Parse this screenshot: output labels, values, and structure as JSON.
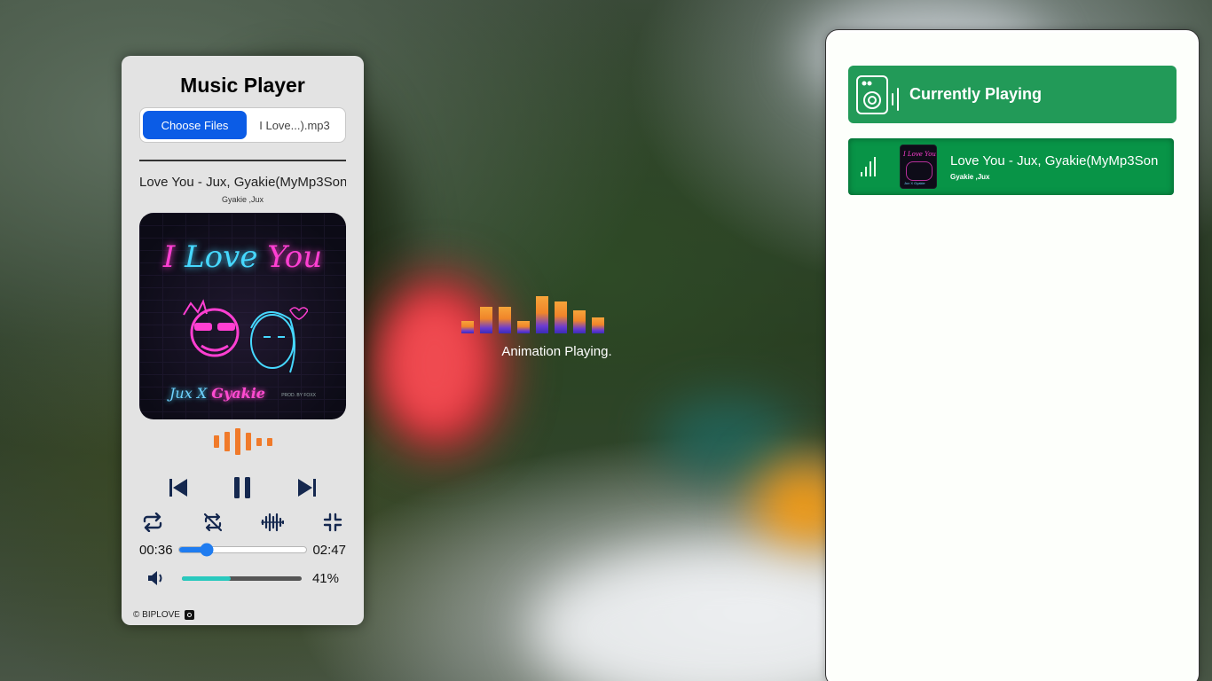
{
  "player": {
    "title": "Music Player",
    "choose_files_label": "Choose Files",
    "file_name": "I Love...).mp3",
    "song_title": "Love You - Jux, Gyakie(MyMp3Song",
    "artist": "Gyakie ,Jux",
    "cover_art": {
      "title_a": "I ",
      "title_b": "Love ",
      "title_c": "You",
      "names_a": "Jux X ",
      "names_b": "Gyakie",
      "prod": "PROD. BY FOXX"
    },
    "current_time": "00:36",
    "duration": "02:47",
    "progress_fraction": 0.22,
    "volume_label": "41%",
    "volume_fraction": 0.41,
    "footer_text": "© BIPLOVE",
    "icons": {
      "previous": "skip-previous-icon",
      "pause": "pause-icon",
      "next": "skip-next-icon",
      "repeat": "repeat-icon",
      "shuffle_off": "shuffle-off-icon",
      "equalizer": "waveform-icon",
      "minimize": "collapse-icon",
      "volume": "volume-icon",
      "github": "github-icon"
    }
  },
  "animation": {
    "status_text": "Animation Playing."
  },
  "queue": {
    "header_title": "Currently Playing",
    "items": [
      {
        "title": "Love You - Jux, Gyakie(MyMp3Song",
        "artist": "Gyakie ,Jux",
        "thumb_title": "I Love You",
        "thumb_names": "Jux X Gyakie"
      }
    ]
  },
  "colors": {
    "choose_button": "#0b5ce6",
    "progress": "#1f7cf0",
    "volume_fill": "#29c9be",
    "visualizer": "#f07a2a",
    "queue_header": "#229a58",
    "queue_item": "#089447"
  }
}
